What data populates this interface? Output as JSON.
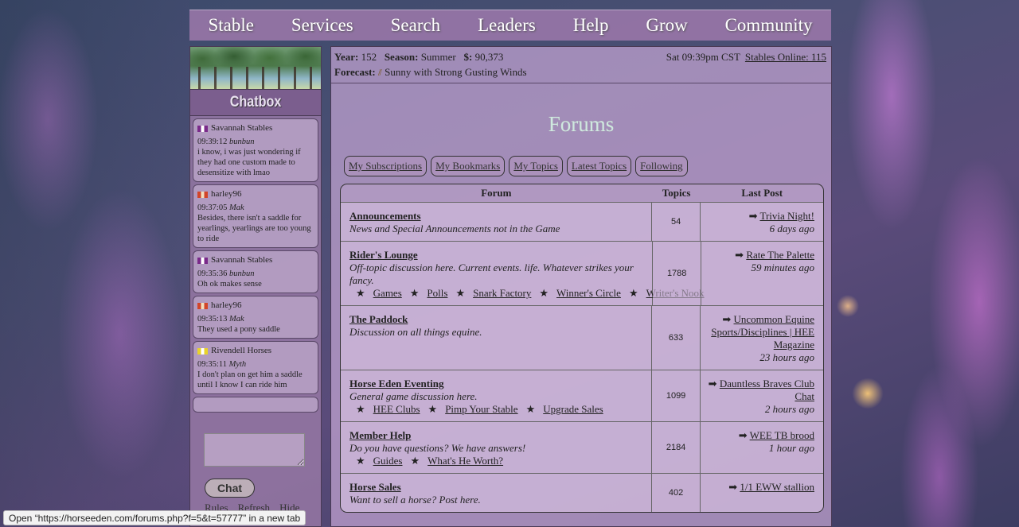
{
  "nav": [
    "Stable",
    "Services",
    "Search",
    "Leaders",
    "Help",
    "Grow",
    "Community"
  ],
  "status": {
    "year_label": "Year:",
    "year": "152",
    "season_label": "Season:",
    "season": "Summer",
    "money_label": "$:",
    "money": "90,373",
    "time": "Sat 09:39pm CST",
    "online": "Stables Online: 115",
    "forecast_label": "Forecast:",
    "forecast_icon": "wind-icon",
    "forecast": "Sunny with Strong Gusting Winds"
  },
  "chat": {
    "title": "Chatbox",
    "messages": [
      {
        "stable": "Savannah Stables",
        "flag": [
          "#7a2a8a",
          "#ffffff"
        ],
        "time": "09:39:12",
        "user": "bunbun",
        "text": "i know, i was just wondering if they had one custom made to desensitize with lmao"
      },
      {
        "stable": "harley96",
        "flag": [
          "#d2452a",
          "#f0e0c0"
        ],
        "time": "09:37:05",
        "user": "Mak",
        "text": "Besides, there isn't a saddle for yearlings, yearlings are too young to ride"
      },
      {
        "stable": "Savannah Stables",
        "flag": [
          "#7a2a8a",
          "#ffffff"
        ],
        "time": "09:35:36",
        "user": "bunbun",
        "text": "Oh ok makes sense"
      },
      {
        "stable": "harley96",
        "flag": [
          "#d2452a",
          "#f0e0c0"
        ],
        "time": "09:35:13",
        "user": "Mak",
        "text": "They used a pony saddle"
      },
      {
        "stable": "Rivendell Horses",
        "flag": [
          "#e8d22a",
          "#ffffff"
        ],
        "time": "09:35:11",
        "user": "Myth",
        "text": "I don't plan on get him a saddle until I know I can ride him"
      }
    ],
    "button": "Chat",
    "links": [
      "Rules",
      "Refresh",
      "Hide"
    ]
  },
  "forums": {
    "title": "Forums",
    "tabs": [
      "My Subscriptions",
      "My Bookmarks",
      "My Topics",
      "Latest Topics",
      "Following"
    ],
    "headers": {
      "forum": "Forum",
      "topics": "Topics",
      "last": "Last Post"
    },
    "rows": [
      {
        "title": "Announcements",
        "desc": "News and Special Announcements not in the Game",
        "subs": [],
        "topics": "54",
        "last_title": "Trivia Night!",
        "last_time": "6 days ago"
      },
      {
        "title": "Rider's Lounge",
        "desc": "Off-topic discussion here. Current events. life. Whatever strikes your fancy.",
        "subs": [
          "Games",
          "Polls",
          "Snark Factory",
          "Winner's Circle",
          "Writer's Nook"
        ],
        "topics": "1788",
        "last_title": "Rate The Palette",
        "last_time": "59 minutes ago"
      },
      {
        "title": "The Paddock",
        "desc": "Discussion on all things equine.",
        "subs": [],
        "topics": "633",
        "last_title": "Uncommon Equine Sports/Disciplines | HEE Magazine",
        "last_time": "23 hours ago"
      },
      {
        "title": "Horse Eden Eventing",
        "desc": "General game discussion here.",
        "subs": [
          "HEE Clubs",
          "Pimp Your Stable",
          "Upgrade Sales"
        ],
        "topics": "1099",
        "last_title": "Dauntless Braves Club Chat",
        "last_time": "2 hours ago"
      },
      {
        "title": "Member Help",
        "desc": "Do you have questions? We have answers!",
        "subs": [
          "Guides",
          "What's He Worth?"
        ],
        "topics": "2184",
        "last_title": "WEE TB brood",
        "last_time": "1 hour ago"
      },
      {
        "title": "Horse Sales",
        "desc": "Want to sell a horse? Post here.",
        "subs": [],
        "topics": "402",
        "last_title": "1/1 EWW stallion",
        "last_time": ""
      }
    ]
  },
  "hover_url": "Open “https://horseeden.com/forums.php?f=5&t=57777” in a new tab"
}
